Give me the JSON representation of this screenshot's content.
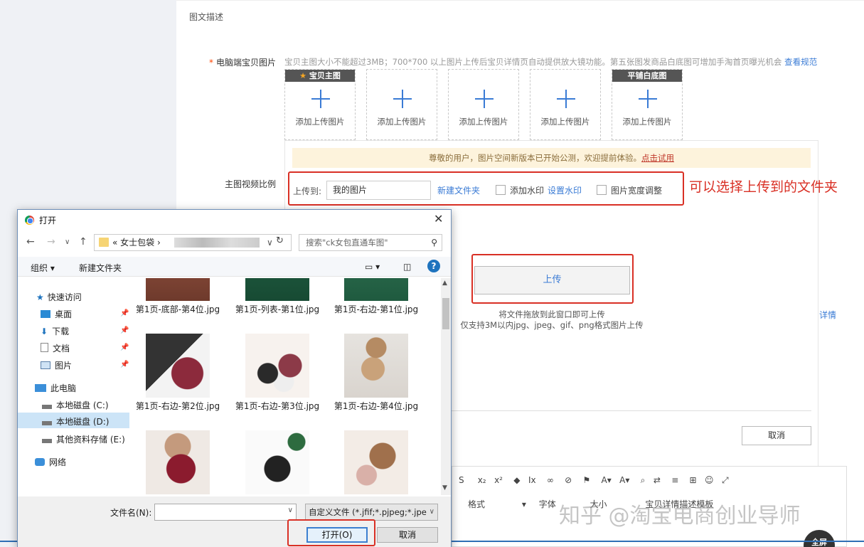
{
  "section_title": "图文描述",
  "pc_images": {
    "label": "电脑端宝贝图片",
    "required_mark": "*",
    "tip": "宝贝主图大小不能超过3MB；700*700 以上图片上传后宝贝详情页自动提供放大镜功能。第五张图发商品白底图可增加手淘首页曝光机会",
    "tip_link": "查看规范",
    "slots": [
      {
        "tag": "宝贝主图",
        "tag_star": "★",
        "label": "添加上传图片"
      },
      {
        "tag": "",
        "label": "添加上传图片"
      },
      {
        "tag": "",
        "label": "添加上传图片"
      },
      {
        "tag": "",
        "label": "添加上传图片"
      },
      {
        "tag": "平铺白底图",
        "label": "添加上传图片"
      }
    ]
  },
  "video_ratio_label": "主图视频比例",
  "notice": {
    "text": "尊敬的用户，图片空间新版本已开始公测，欢迎提前体验。",
    "link": "点击试用"
  },
  "upload_to": {
    "label": "上传到:",
    "folder": "我的图片",
    "new_folder": "新建文件夹",
    "watermark": "添加水印",
    "watermark_settings": "设置水印",
    "resize": "图片宽度调整"
  },
  "annotation": "可以选择上传到的文件夹",
  "upload_button": "上传",
  "drop_tip": "将文件拖放到此窗口即可上传",
  "format_tip": "仅支持3M以内jpg、jpeg、gif、png格式图片上传",
  "side_link": "详情",
  "cancel_button": "取消",
  "editor_toolbar": {
    "format": "格式",
    "font": "字体",
    "size": "大小",
    "detail": "宝贝详情描述模板"
  },
  "watermark_text": "知乎 @淘宝电商创业导师",
  "fullscreen": "全屏",
  "dialog": {
    "title": "打开",
    "address_prefix": "«",
    "address_path": "女士包袋",
    "search_placeholder": "搜索\"ck女包直通车图\"",
    "organize": "组织",
    "new_folder": "新建文件夹",
    "nav": [
      {
        "label": "快速访问",
        "icon": "star-icon"
      },
      {
        "label": "桌面",
        "icon": "desktop-icon",
        "pinned": true
      },
      {
        "label": "下载",
        "icon": "download-icon",
        "pinned": true
      },
      {
        "label": "文档",
        "icon": "document-icon",
        "pinned": true
      },
      {
        "label": "图片",
        "icon": "picture-icon",
        "pinned": true
      },
      {
        "label": "此电脑",
        "icon": "computer-icon"
      },
      {
        "label": "本地磁盘 (C:)",
        "icon": "drive-icon"
      },
      {
        "label": "本地磁盘 (D:)",
        "icon": "drive-icon",
        "selected": true
      },
      {
        "label": "其他资料存储 (E:)",
        "icon": "drive-icon"
      },
      {
        "label": "网络",
        "icon": "network-icon"
      }
    ],
    "files": [
      {
        "name": "第1页-底部-第4位.jpg"
      },
      {
        "name": "第1页-列表-第1位.jpg"
      },
      {
        "name": "第1页-右边-第1位.jpg"
      },
      {
        "name": "第1页-右边-第2位.jpg"
      },
      {
        "name": "第1页-右边-第3位.jpg"
      },
      {
        "name": "第1页-右边-第4位.jpg"
      },
      {
        "name": ""
      },
      {
        "name": ""
      },
      {
        "name": ""
      }
    ],
    "filename_label": "文件名(N):",
    "filename_value": "",
    "filter": "自定义文件 (*.jfif;*.pjpeg;*.jpe",
    "open": "打开(O)",
    "cancel": "取消"
  },
  "colors": {
    "accent": "#3a7bd5",
    "highlight": "#d93025",
    "notice_bg": "#fdf3dc"
  }
}
